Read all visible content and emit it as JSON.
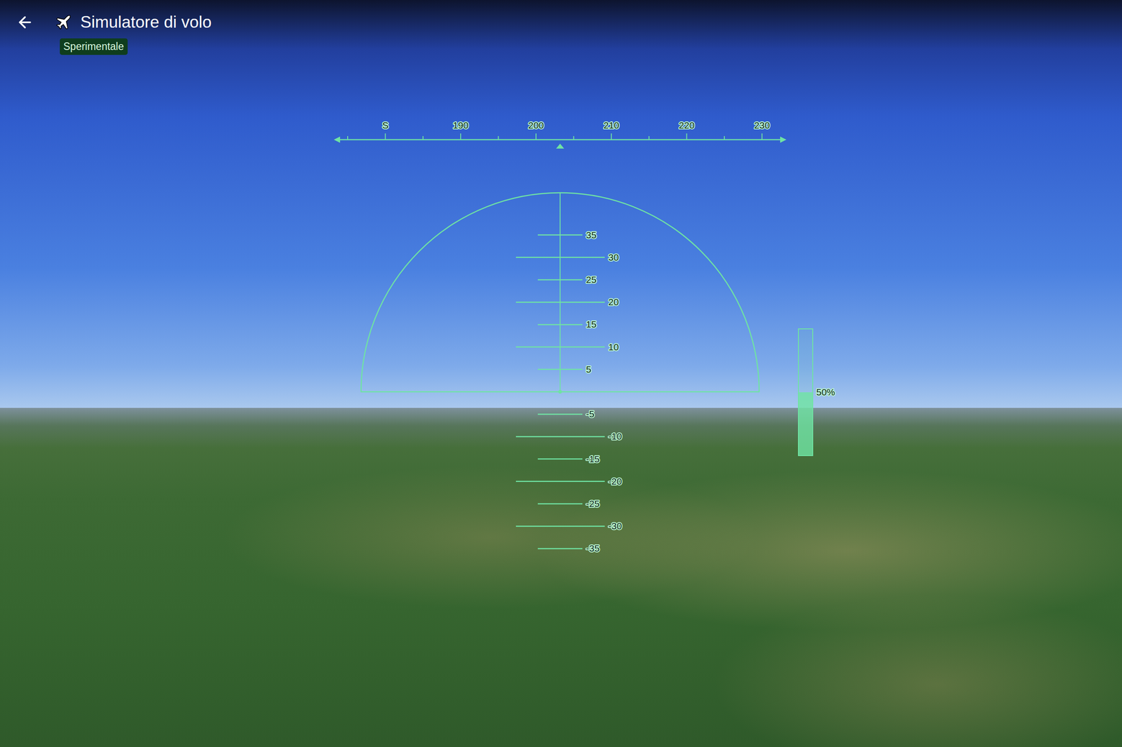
{
  "window": {
    "title": "Simulatore di volo",
    "badge": "Sperimentale"
  },
  "compass": {
    "heading": 203.2,
    "start": 180,
    "step": 10,
    "labels": [
      "S",
      "190",
      "200",
      "210",
      "220",
      "230"
    ]
  },
  "pitch_ladder": {
    "pitch": 0,
    "marks": [
      {
        "value": 35,
        "label": "35"
      },
      {
        "value": 30,
        "label": "30"
      },
      {
        "value": 25,
        "label": "25"
      },
      {
        "value": 20,
        "label": "20"
      },
      {
        "value": 15,
        "label": "15"
      },
      {
        "value": 10,
        "label": "10"
      },
      {
        "value": 5,
        "label": "5"
      },
      {
        "value": -5,
        "label": "-5"
      },
      {
        "value": -10,
        "label": "-10"
      },
      {
        "value": -15,
        "label": "-15"
      },
      {
        "value": -20,
        "label": "-20"
      },
      {
        "value": -25,
        "label": "-25"
      },
      {
        "value": -30,
        "label": "-30"
      },
      {
        "value": -35,
        "label": "-35"
      }
    ]
  },
  "throttle": {
    "level": 0.5,
    "reading": "50%"
  }
}
